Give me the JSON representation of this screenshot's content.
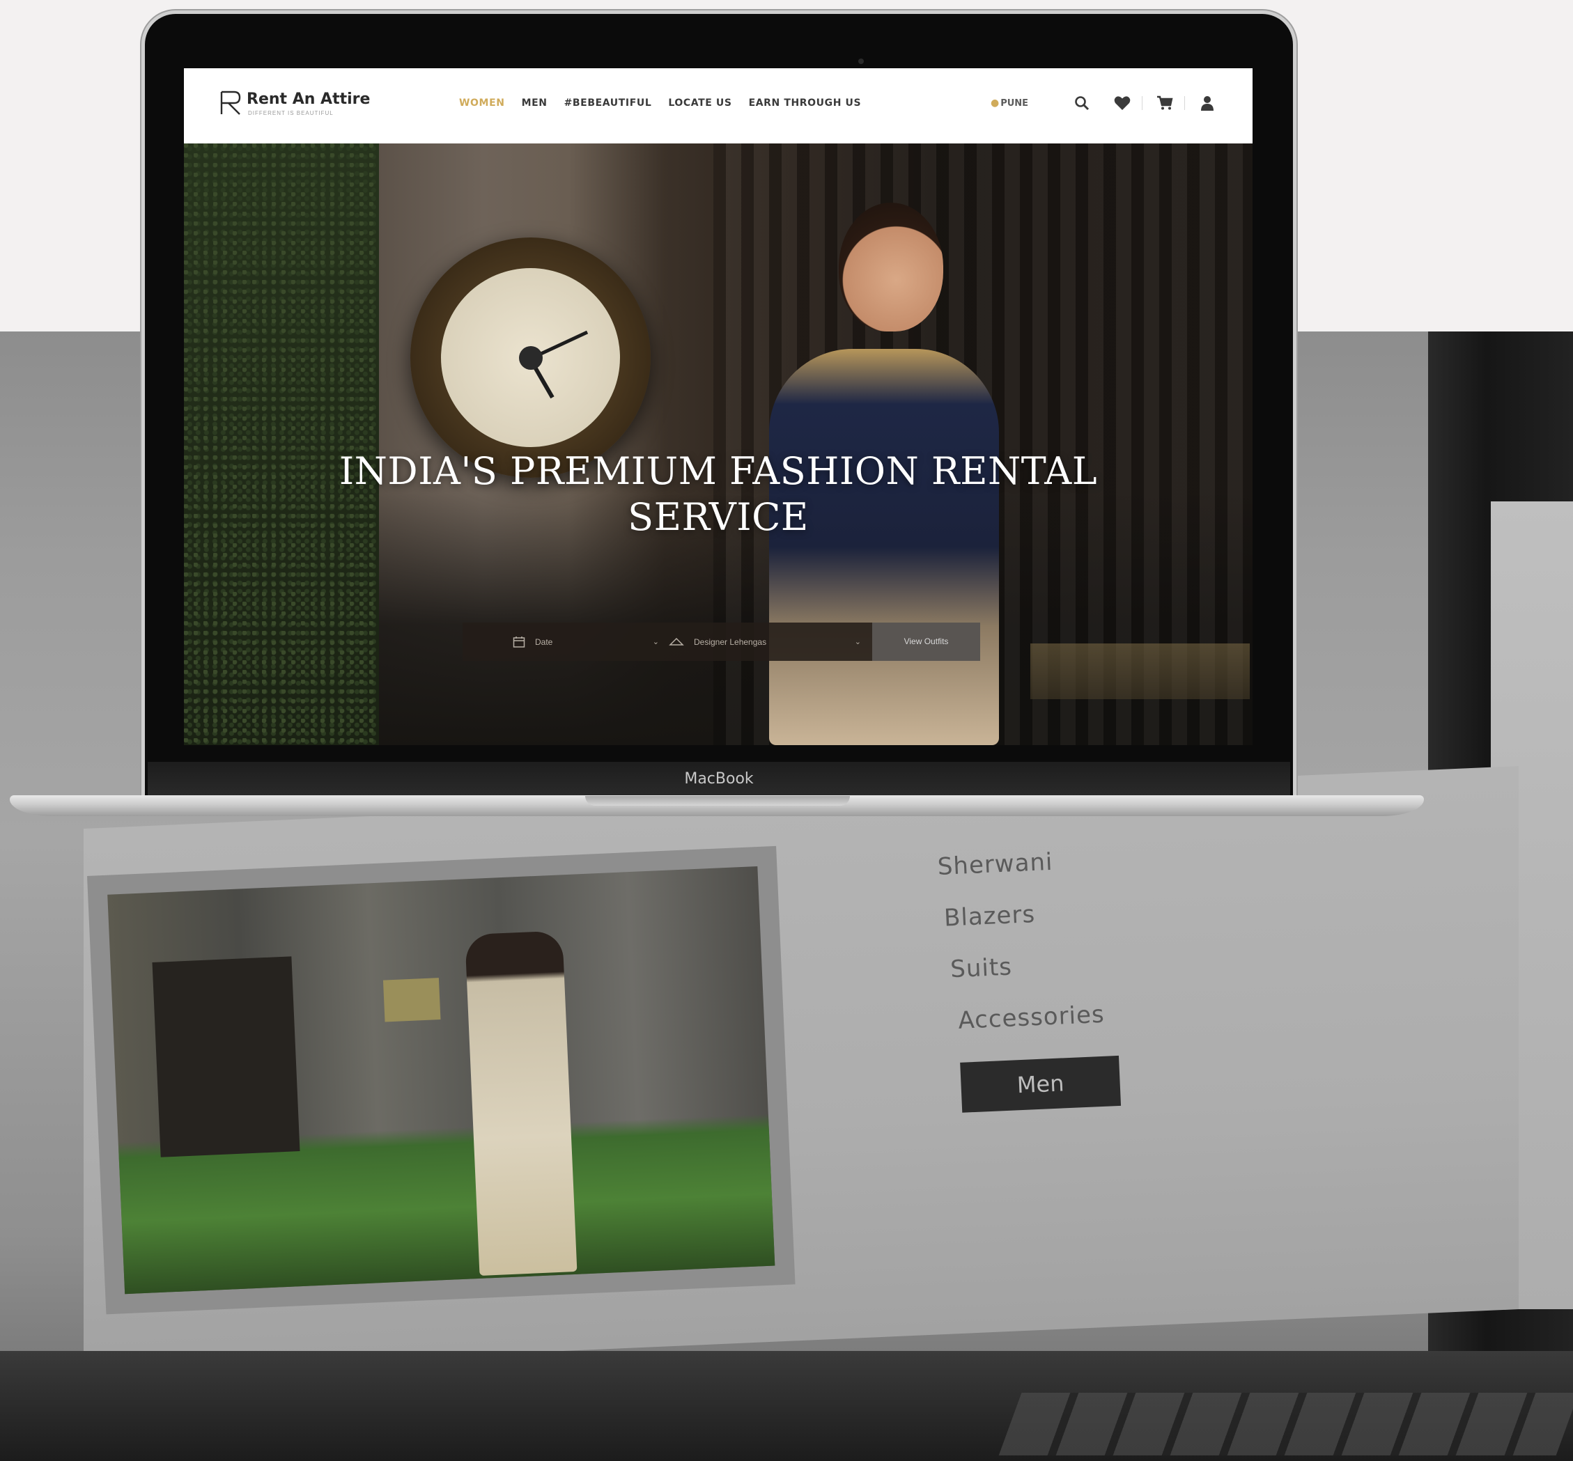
{
  "device": {
    "brand_label": "MacBook"
  },
  "site": {
    "logo": {
      "name": "Rent An Attire",
      "tagline": "DIFFERENT IS BEAUTIFUL"
    },
    "nav": [
      {
        "label": "WOMEN",
        "active": true
      },
      {
        "label": "MEN",
        "active": false
      },
      {
        "label": "#BEBEAUTIFUL",
        "active": false
      },
      {
        "label": "LOCATE US",
        "active": false
      },
      {
        "label": "EARN THROUGH US",
        "active": false
      }
    ],
    "city": "PUNE",
    "header_icons": [
      "search-icon",
      "heart-icon",
      "cart-icon",
      "user-icon"
    ],
    "hero": {
      "title_line1": "INDIA'S PREMIUM FASHION RENTAL",
      "title_line2": "SERVICE",
      "search": {
        "date_label": "Date",
        "outfit_label": "Designer Lehengas",
        "button_label": "View Outfits"
      }
    },
    "colors": {
      "accent": "#d0ab5b",
      "header_bg": "#ffffff",
      "text_dark": "#3a3a3a"
    }
  },
  "background_page": {
    "menu_items": [
      "Sherwani",
      "Blazers",
      "Suits",
      "Accessories"
    ],
    "button_label": "Men"
  }
}
